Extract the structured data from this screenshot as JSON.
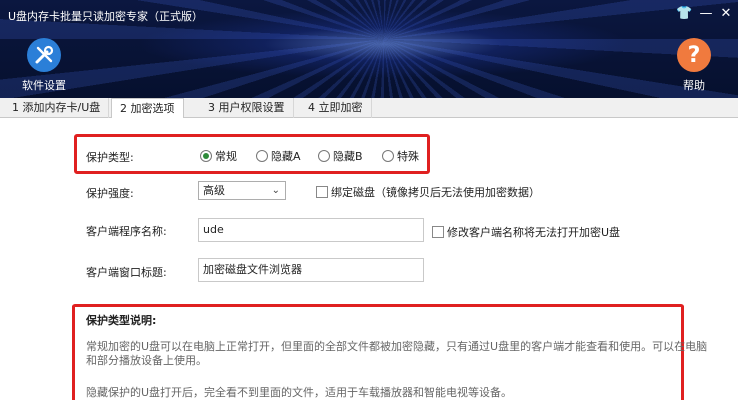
{
  "window": {
    "title": "U盘内存卡批量只读加密专家（正式版）",
    "controls": [
      "👕",
      "—",
      "✕"
    ]
  },
  "toolbar": {
    "settings_label": "软件设置",
    "help_label": "帮助",
    "help_glyph": "?"
  },
  "tabs": [
    {
      "label": "1 添加内存卡/U盘"
    },
    {
      "label": "2 加密选项"
    },
    {
      "label": "3 用户权限设置"
    },
    {
      "label": "4 立即加密"
    }
  ],
  "form": {
    "protect_type_label": "保护类型:",
    "protect_options": [
      {
        "label": "常规",
        "selected": true
      },
      {
        "label": "隐藏A",
        "selected": false
      },
      {
        "label": "隐藏B",
        "selected": false
      },
      {
        "label": "特殊",
        "selected": false
      }
    ],
    "strength_label": "保护强度:",
    "strength_value": "高级",
    "bind_disk_label": "绑定磁盘（镜像拷贝后无法使用加密数据）",
    "client_name_label": "客户端程序名称:",
    "client_name_value": "ude",
    "modify_client_label": "修改客户端名称将无法打开加密U盘",
    "window_title_label": "客户端窗口标题:",
    "window_title_value": "加密磁盘文件浏览器"
  },
  "description": {
    "title": "保护类型说明:",
    "para1_line1": "常规加密的U盘可以在电脑上正常打开，但里面的全部文件都被加密隐藏，只有通过U盘里的客户端才能查看和使用。可以在电脑",
    "para1_line2": "和部分播放设备上使用。",
    "para2": "隐藏保护的U盘打开后，完全看不到里面的文件，适用于车载播放器和智能电视等设备。"
  },
  "colors": {
    "highlight_border": "#e02020",
    "settings_icon_bg": "#2b7fd8",
    "help_icon_bg": "#f07a3e",
    "radio_selected": "#2e8b3a"
  }
}
